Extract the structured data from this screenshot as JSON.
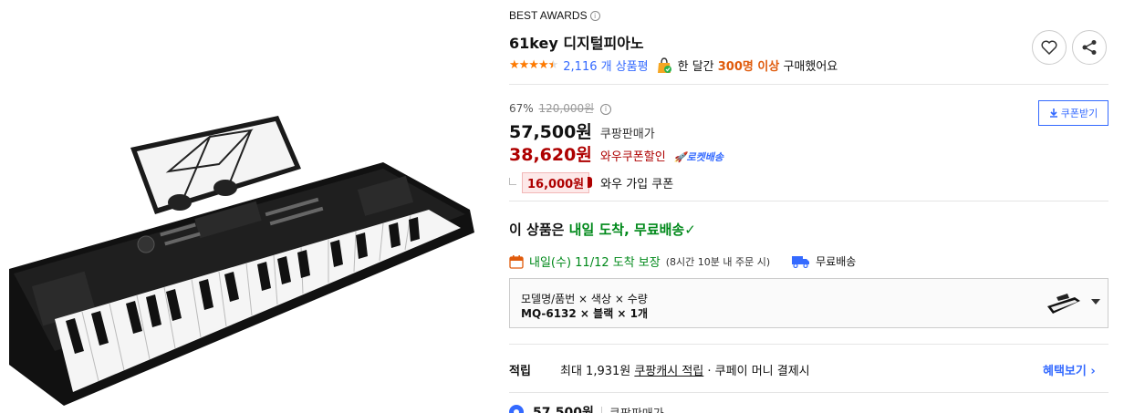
{
  "header": {
    "badge": "BEST AWARDS",
    "title": "61key 디지털피아노"
  },
  "rating": {
    "stars": 4.5,
    "review_count": "2,116 개 상품평",
    "purchase_prefix": "한 달간",
    "purchase_highlight": "300명 이상",
    "purchase_suffix": "구매했어요"
  },
  "price": {
    "discount_rate": "67%",
    "original_price": "120,000원",
    "sale_price": "57,500원",
    "sale_label": "쿠팡판매가",
    "wow_price": "38,620원",
    "wow_label": "와우쿠폰할인",
    "rocket_label": "로켓배송",
    "coupon_amount": "16,000원",
    "coupon_label": "와우 가입 쿠폰",
    "coupon_download_label": "쿠폰받기"
  },
  "delivery": {
    "headline_prefix": "이 상품은",
    "headline_highlight": "내일 도착, 무료배송",
    "date_text": "내일(수) 11/12 도착 보장",
    "date_note": "(8시간 10분 내 주문 시)",
    "free_shipping_label": "무료배송"
  },
  "option": {
    "labels": "모델명/품번 × 색상 × 수량",
    "values": "MQ-6132 × 블랙 × 1개"
  },
  "reward": {
    "title": "적립",
    "prefix": "최대 1,931원",
    "link": "쿠팡캐시 적립",
    "suffix": "· 쿠페이 머니 결제시",
    "benefit_link": "혜택보기 ›"
  },
  "bottom": {
    "price": "57,500원",
    "label": "쿠팡판매가"
  },
  "colors": {
    "accent_blue": "#346aff",
    "wow_red": "#ae0000",
    "delivery_green": "#00891a",
    "star_orange": "#ff7a00",
    "purchase_orange": "#e05b0c"
  },
  "icons": [
    "info-icon",
    "heart-icon",
    "share-icon",
    "bag-icon",
    "download-icon",
    "rocket-icon",
    "check-icon",
    "calendar-icon",
    "truck-icon",
    "chevron-down-icon"
  ]
}
